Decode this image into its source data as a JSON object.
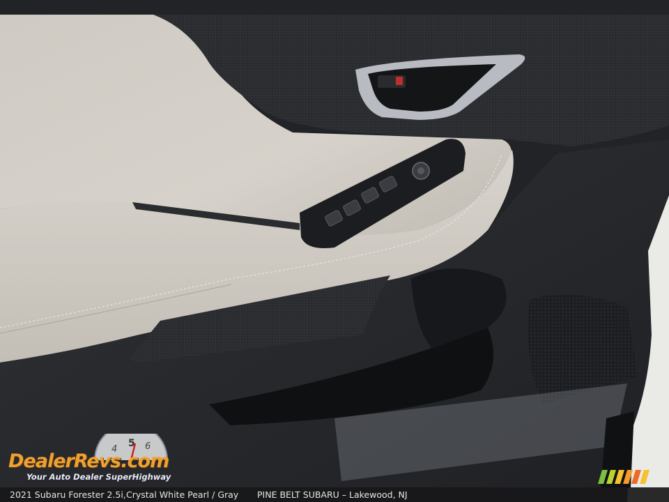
{
  "caption": {
    "vehicle": "2021 Subaru Forester 2.5i,",
    "color": "Crystal White Pearl / Gray",
    "dealer": "PINE BELT SUBARU – Lakewood, NJ"
  },
  "watermark": {
    "logo_text": "DealerRevs.com",
    "tagline": "Your Auto Dealer SuperHighway",
    "gauge_digits": [
      "4",
      "5",
      "6"
    ]
  },
  "colors": {
    "door_panel_leather": "#d2cdc6",
    "door_trim_dark": "#2a2c30",
    "trim_accent_silver": "#b8bcc2",
    "logo_orange": "#f0a030",
    "logo_blue": "#2d56b8"
  }
}
